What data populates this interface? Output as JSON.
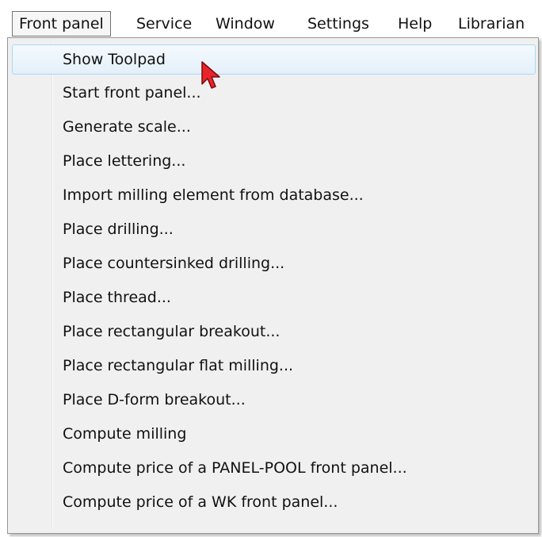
{
  "menubar": {
    "items": [
      {
        "label": "Front panel"
      },
      {
        "label": "Service"
      },
      {
        "label": "Window"
      },
      {
        "label": "Settings"
      },
      {
        "label": "Help"
      },
      {
        "label": "Librarian"
      }
    ]
  },
  "dropdown": {
    "items": [
      {
        "label": "Show Toolpad"
      },
      {
        "label": "Start front panel..."
      },
      {
        "label": "Generate scale..."
      },
      {
        "label": "Place lettering..."
      },
      {
        "label": "Import milling element from database..."
      },
      {
        "label": "Place drilling..."
      },
      {
        "label": "Place countersinked drilling..."
      },
      {
        "label": "Place thread..."
      },
      {
        "label": "Place rectangular breakout..."
      },
      {
        "label": "Place rectangular flat milling..."
      },
      {
        "label": "Place D-form breakout..."
      },
      {
        "label": "Compute milling"
      },
      {
        "label": "Compute price of a PANEL-POOL front panel..."
      },
      {
        "label": "Compute price of a WK front panel..."
      }
    ]
  },
  "colors": {
    "cursor": "#e8242a",
    "highlight_border": "#a8d8f5",
    "menu_bg": "#f0f0f0"
  },
  "icons": {
    "cursor": "mouse-pointer-icon"
  }
}
